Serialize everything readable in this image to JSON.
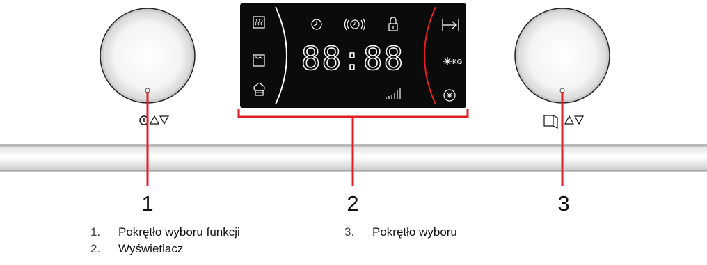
{
  "callouts": [
    {
      "number": "1",
      "label": "Pokrętło wyboru funkcji"
    },
    {
      "number": "2",
      "label": "Wyświetlacz"
    },
    {
      "number": "3",
      "label": "Pokrętło wyboru"
    }
  ],
  "legend": [
    {
      "index": "1.",
      "label": "Pokrętło wyboru funkcji"
    },
    {
      "index": "2.",
      "label": "Wyświetlacz"
    },
    {
      "index": "3.",
      "label": "Pokrętło wyboru"
    }
  ],
  "display": {
    "time": "88:88",
    "weight_label": "KG",
    "icons_left": [
      "grill-icon",
      "top-bottom-heat-icon",
      "chef-hat-icon"
    ],
    "icons_top": [
      "clock-icon",
      "alarm-icon",
      "lock-icon"
    ],
    "icons_right": [
      "end-time-icon",
      "defrost-kg-icon",
      "defrost-icon"
    ],
    "indicator": "signal-bars-icon"
  },
  "colors": {
    "callout_line": "#e31e24",
    "display_bg": "#0b0b0b",
    "display_text": "#ffffff",
    "arc_right": "#e31e24"
  }
}
